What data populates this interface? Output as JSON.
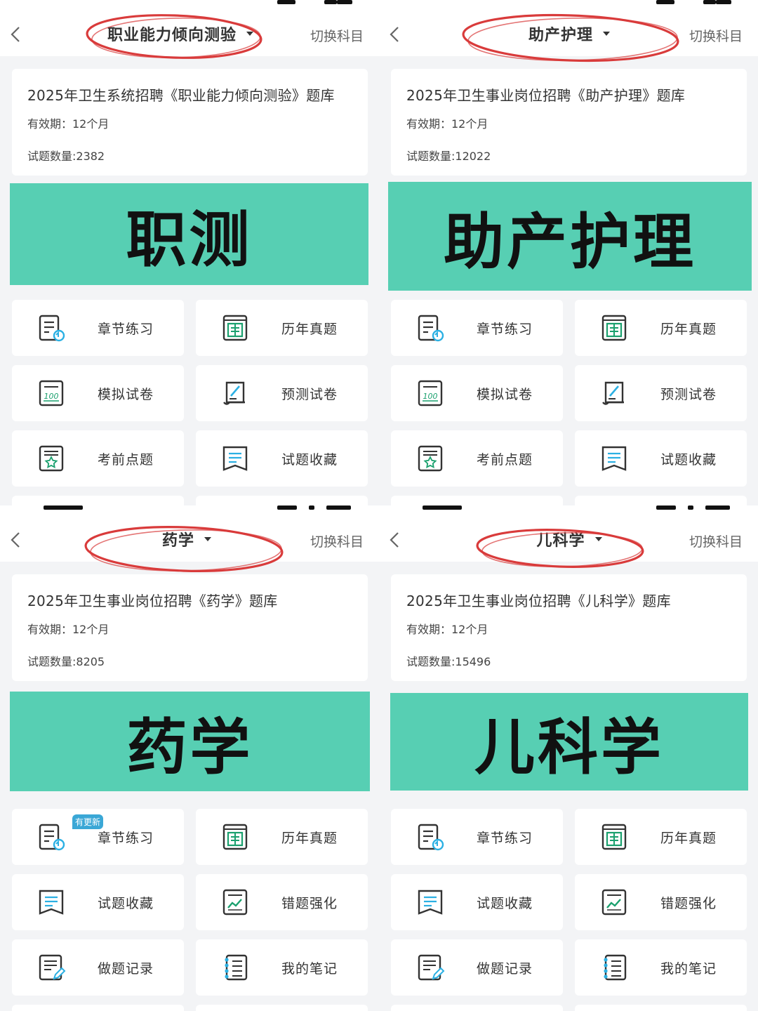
{
  "switch_label": "切换科目",
  "ellipse_color": "#d93b3b",
  "banner_color": "#57cfb3",
  "badge_color": "#3aa7d6",
  "panels": [
    {
      "title": "职业能力倾向测验",
      "info_title": "2025年卫生系统招聘《职业能力倾向测验》题库",
      "validity": "有效期：12个月",
      "count": "试题数量:2382",
      "banner": "职测",
      "menu": [
        {
          "label": "章节练习",
          "icon": "chapter-practice-icon"
        },
        {
          "label": "历年真题",
          "icon": "past-exam-icon"
        },
        {
          "label": "模拟试卷",
          "icon": "mock-paper-icon"
        },
        {
          "label": "预测试卷",
          "icon": "prediction-paper-icon"
        },
        {
          "label": "考前点题",
          "icon": "pre-exam-tips-icon"
        },
        {
          "label": "试题收藏",
          "icon": "bookmark-icon"
        }
      ]
    },
    {
      "title": "助产护理",
      "info_title": "2025年卫生事业岗位招聘《助产护理》题库",
      "validity": "有效期：12个月",
      "count": "试题数量:12022",
      "banner": "助产护理",
      "menu": [
        {
          "label": "章节练习",
          "icon": "chapter-practice-icon"
        },
        {
          "label": "历年真题",
          "icon": "past-exam-icon"
        },
        {
          "label": "模拟试卷",
          "icon": "mock-paper-icon"
        },
        {
          "label": "预测试卷",
          "icon": "prediction-paper-icon"
        },
        {
          "label": "考前点题",
          "icon": "pre-exam-tips-icon"
        },
        {
          "label": "试题收藏",
          "icon": "bookmark-icon"
        }
      ]
    },
    {
      "title": "药学",
      "info_title": "2025年卫生事业岗位招聘《药学》题库",
      "validity": "有效期：12个月",
      "count": "试题数量:8205",
      "banner": "药学",
      "badge": "有更新",
      "menu": [
        {
          "label": "章节练习",
          "icon": "chapter-practice-icon"
        },
        {
          "label": "历年真题",
          "icon": "past-exam-icon"
        },
        {
          "label": "试题收藏",
          "icon": "bookmark-icon"
        },
        {
          "label": "错题强化",
          "icon": "wrong-question-icon"
        },
        {
          "label": "做题记录",
          "icon": "practice-record-icon"
        },
        {
          "label": "我的笔记",
          "icon": "notes-icon"
        }
      ]
    },
    {
      "title": "儿科学",
      "info_title": "2025年卫生事业岗位招聘《儿科学》题库",
      "validity": "有效期：12个月",
      "count": "试题数量:15496",
      "banner": "儿科学",
      "menu": [
        {
          "label": "章节练习",
          "icon": "chapter-practice-icon"
        },
        {
          "label": "历年真题",
          "icon": "past-exam-icon"
        },
        {
          "label": "试题收藏",
          "icon": "bookmark-icon"
        },
        {
          "label": "错题强化",
          "icon": "wrong-question-icon"
        },
        {
          "label": "做题记录",
          "icon": "practice-record-icon"
        },
        {
          "label": "我的笔记",
          "icon": "notes-icon"
        }
      ]
    }
  ]
}
